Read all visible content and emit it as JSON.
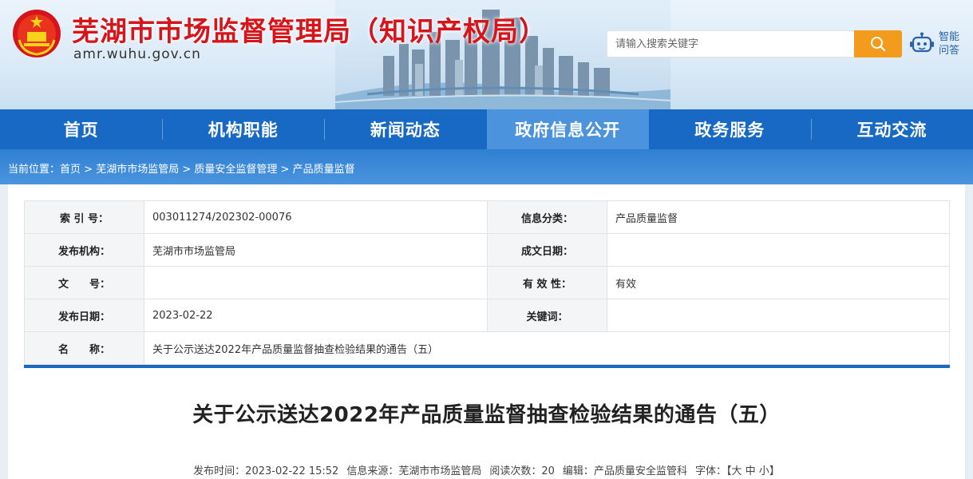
{
  "header": {
    "title": "芜湖市市场监督管理局（知识产权局）",
    "domain": "amr.wuhu.gov.cn",
    "search_placeholder": "请输入搜索关键字",
    "qa_label": "智能问答"
  },
  "nav": {
    "items": [
      "首页",
      "机构职能",
      "新闻动态",
      "政府信息公开",
      "政务服务",
      "互动交流"
    ],
    "active_index": 3
  },
  "breadcrumb": {
    "prefix": "当前位置：",
    "items": [
      "首页",
      "芜湖市市场监管局",
      "质量安全监督管理",
      "产品质量监督"
    ],
    "separator": " > "
  },
  "meta": {
    "index_label": "索 引 号：",
    "index_value": "003011274/202302-00076",
    "category_label": "信息分类：",
    "category_value": "产品质量监督",
    "publisher_label": "发布机构：",
    "publisher_value": "芜湖市市场监管局",
    "created_label": "成文日期：",
    "created_value": "",
    "docno_label": "文　　号：",
    "docno_value": "",
    "validity_label": "有 效 性：",
    "validity_value": "有效",
    "pubdate_label": "发布日期：",
    "pubdate_value": "2023-02-22",
    "keywords_label": "关键词：",
    "keywords_value": "",
    "name_label": "名　　称：",
    "name_value": "关于公示送达2022年产品质量监督抽查检验结果的通告（五）"
  },
  "article": {
    "title": "关于公示送达2022年产品质量监督抽查检验结果的通告（五）",
    "time_label": "发布时间：",
    "time_value": "2023-02-22 15:52",
    "source_label": "信息来源：",
    "source_value": "芜湖市市场监管局",
    "views_label": "阅读次数：",
    "views_value": "20",
    "editor_label": "编辑：",
    "editor_value": "产品质量安全监管科",
    "font_label": "字体：",
    "font_open": "【",
    "font_large": "大",
    "font_medium": "中",
    "font_small": "小",
    "font_close": "】"
  },
  "colors": {
    "title_red": "#d7141a",
    "nav_blue": "#1769c4",
    "nav_active": "#4b93dc",
    "search_orange": "#f39b1c"
  }
}
